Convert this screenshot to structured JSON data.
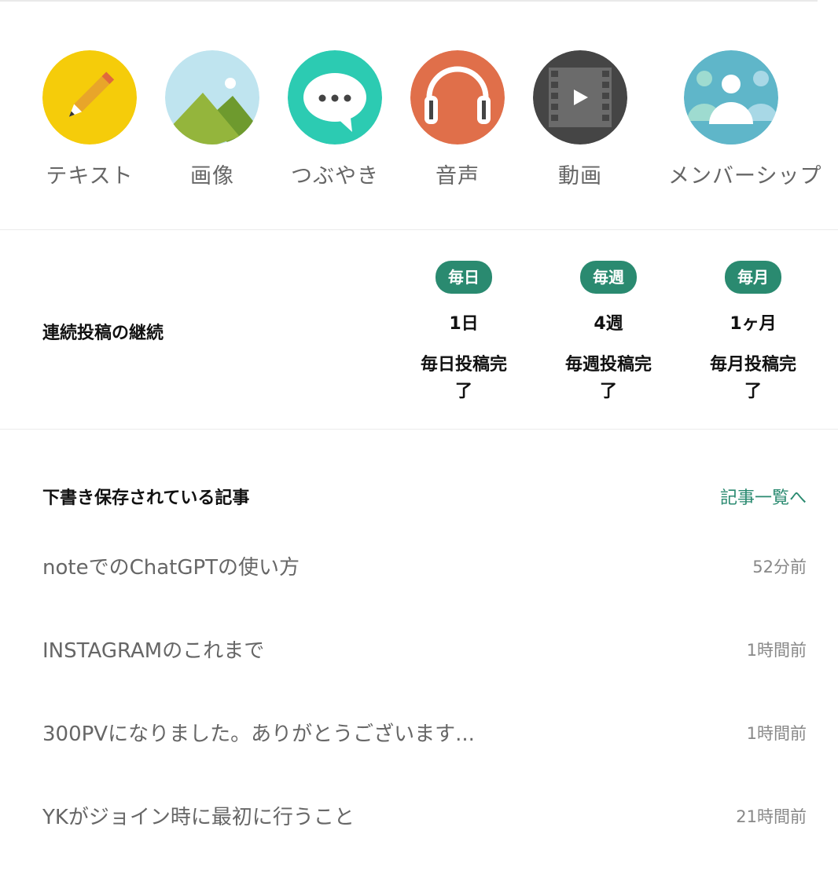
{
  "post_types": [
    {
      "label": "テキスト",
      "icon": "pencil-icon",
      "color": "#f5cc0a"
    },
    {
      "label": "画像",
      "icon": "image-icon",
      "color": "#bfe4ef"
    },
    {
      "label": "つぶやき",
      "icon": "speech-bubble-icon",
      "color": "#2ccbb2"
    },
    {
      "label": "音声",
      "icon": "headphones-icon",
      "color": "#e06f4a"
    },
    {
      "label": "動画",
      "icon": "video-icon",
      "color": "#454545"
    },
    {
      "label": "メンバーシップ",
      "icon": "members-icon",
      "color": "#5fb6c9"
    }
  ],
  "streak": {
    "title": "連続投稿の継続",
    "columns": [
      {
        "badge": "毎日",
        "count": "1日",
        "status": "毎日投稿完了"
      },
      {
        "badge": "毎週",
        "count": "4週",
        "status": "毎週投稿完了"
      },
      {
        "badge": "毎月",
        "count": "1ヶ月",
        "status": "毎月投稿完了"
      }
    ]
  },
  "drafts": {
    "title": "下書き保存されている記事",
    "link": "記事一覧へ",
    "items": [
      {
        "title": "noteでのChatGPTの使い方",
        "time": "52分前"
      },
      {
        "title": "INSTAGRAMのこれまで",
        "time": "1時間前"
      },
      {
        "title": "300PVになりました。ありがとうございます...",
        "time": "1時間前"
      },
      {
        "title": "YKがジョイン時に最初に行うこと",
        "time": "21時間前"
      }
    ]
  },
  "colors": {
    "accent": "#2a8a70"
  }
}
